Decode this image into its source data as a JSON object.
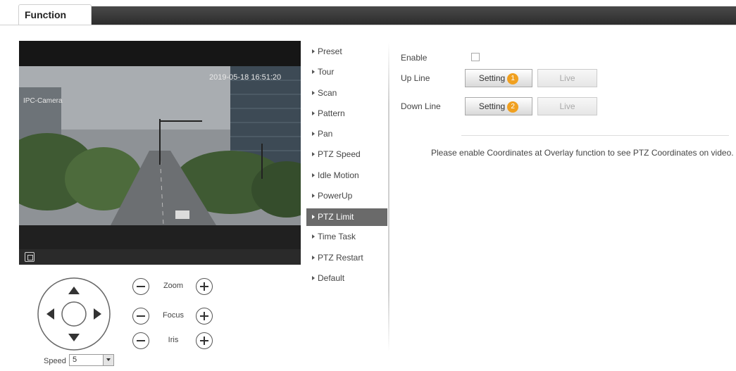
{
  "header": {
    "tab_label": "Function"
  },
  "video": {
    "timestamp": "2019-05-18 16:51:20",
    "channel_name": "IPC-Camera"
  },
  "ptz": {
    "zoom_label": "Zoom",
    "focus_label": "Focus",
    "iris_label": "Iris",
    "speed_label": "Speed",
    "speed_value": "5"
  },
  "menu": {
    "items": [
      {
        "label": "Preset"
      },
      {
        "label": "Tour"
      },
      {
        "label": "Scan"
      },
      {
        "label": "Pattern"
      },
      {
        "label": "Pan"
      },
      {
        "label": "PTZ Speed"
      },
      {
        "label": "Idle Motion"
      },
      {
        "label": "PowerUp"
      },
      {
        "label": "PTZ Limit",
        "active": true
      },
      {
        "label": "Time Task"
      },
      {
        "label": "PTZ Restart"
      },
      {
        "label": "Default"
      }
    ]
  },
  "limit": {
    "enable_label": "Enable",
    "up_line_label": "Up Line",
    "down_line_label": "Down Line",
    "setting_label": "Setting",
    "live_label": "Live",
    "up_badge": "1",
    "down_badge": "2",
    "note": "Please enable Coordinates at Overlay function to see PTZ Coordinates on video."
  },
  "colors": {
    "active_menu": "#6a6a6a",
    "badge": "#f0a020",
    "header_bar": "#3a3a3a"
  }
}
